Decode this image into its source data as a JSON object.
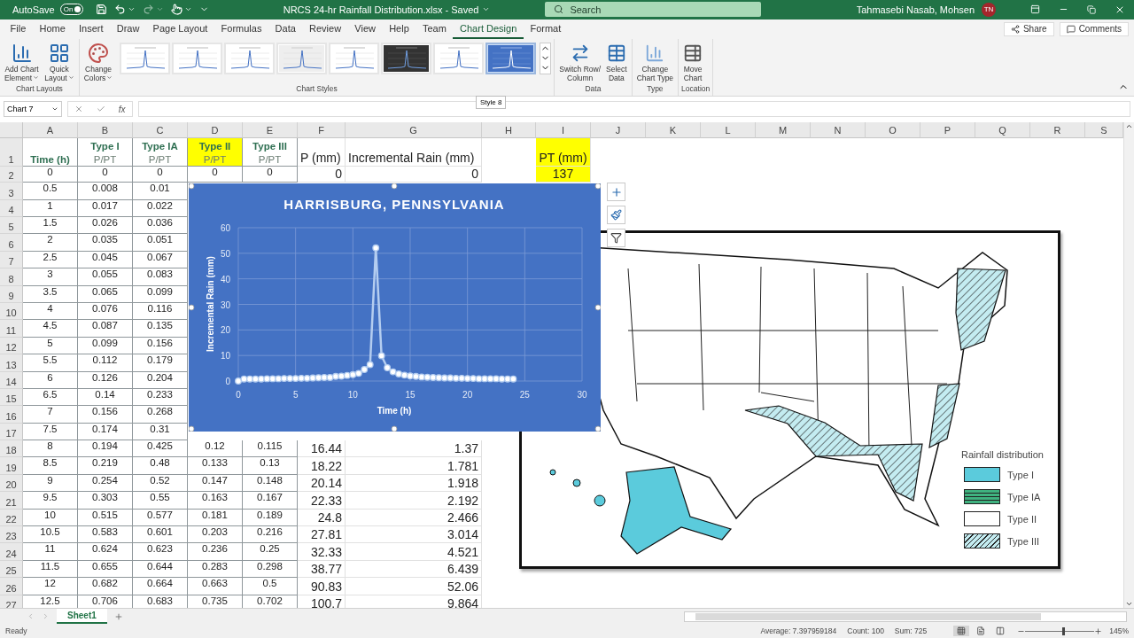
{
  "title_bar": {
    "autosave": {
      "label": "AutoSave",
      "toggle": "On",
      "on": true
    },
    "document": "NRCS 24-hr Rainfall Distribution.xlsx  -  Saved",
    "search": {
      "placeholder": "Search"
    },
    "user": "Tahmasebi Nasab, Mohsen",
    "avatar": "TN"
  },
  "tabs": [
    {
      "label": "File",
      "selected": false
    },
    {
      "label": "Home",
      "selected": false
    },
    {
      "label": "Insert",
      "selected": false
    },
    {
      "label": "Draw",
      "selected": false
    },
    {
      "label": "Page Layout",
      "selected": false
    },
    {
      "label": "Formulas",
      "selected": false
    },
    {
      "label": "Data",
      "selected": false
    },
    {
      "label": "Review",
      "selected": false
    },
    {
      "label": "View",
      "selected": false
    },
    {
      "label": "Help",
      "selected": false
    },
    {
      "label": "Team",
      "selected": false
    },
    {
      "label": "Chart Design",
      "selected": true
    },
    {
      "label": "Format",
      "selected": false
    }
  ],
  "share": "Share",
  "comments": "Comments",
  "ribbon": {
    "groups": [
      {
        "label": "Chart Layouts",
        "buttons": [
          {
            "kind": "element",
            "lines": [
              "Add Chart",
              "Element"
            ],
            "dropdown": true
          },
          {
            "kind": "layout",
            "lines": [
              "Quick",
              "Layout"
            ],
            "dropdown": true
          }
        ]
      },
      {
        "label": "Chart Styles",
        "buttons": [
          {
            "kind": "colors",
            "lines": [
              "Change",
              "Colors"
            ],
            "dropdown": true
          }
        ],
        "gallery": [
          {
            "kind": "light",
            "selected": false
          },
          {
            "kind": "light",
            "selected": false
          },
          {
            "kind": "light",
            "selected": false
          },
          {
            "kind": "shaded",
            "selected": false
          },
          {
            "kind": "light",
            "selected": false
          },
          {
            "kind": "dark",
            "selected": false
          },
          {
            "kind": "light",
            "selected": false
          },
          {
            "kind": "blue",
            "selected": true
          }
        ]
      },
      {
        "label": "Data",
        "buttons": [
          {
            "kind": "switch",
            "lines": [
              "Switch Row/",
              "Column"
            ],
            "dropdown": false
          },
          {
            "kind": "select",
            "lines": [
              "Select",
              "Data"
            ],
            "dropdown": false
          }
        ]
      },
      {
        "label": "Type",
        "buttons": [
          {
            "kind": "type",
            "lines": [
              "Change",
              "Chart Type"
            ],
            "dropdown": false
          }
        ]
      },
      {
        "label": "Location",
        "buttons": [
          {
            "kind": "move",
            "lines": [
              "Move",
              "Chart"
            ],
            "dropdown": false
          }
        ]
      }
    ],
    "tooltip": "Style 8"
  },
  "formula_bar": {
    "name_box": "Chart 7",
    "function_label": "fx"
  },
  "sheet": {
    "columns": [
      "A",
      "B",
      "C",
      "D",
      "E",
      "F",
      "G",
      "H",
      "I",
      "J",
      "K",
      "L",
      "M",
      "N",
      "O",
      "P",
      "Q",
      "R",
      "S"
    ],
    "rows": [
      {
        "number": "1",
        "cells": [
          {
            "kind": "header",
            "title": "Time (h)"
          },
          {
            "kind": "header",
            "title": "Type I",
            "unit": "P/PT"
          },
          {
            "kind": "header",
            "title": "Type IA",
            "unit": "P/PT"
          },
          {
            "kind": "header",
            "title": "Type II",
            "unit": "P/PT",
            "highlighted": true
          },
          {
            "kind": "header",
            "title": "Type III",
            "unit": "P/PT"
          },
          {
            "kind": "label",
            "text": "P (mm)"
          },
          {
            "kind": "label",
            "text": "Incremental Rain (mm)"
          },
          null,
          {
            "kind": "label",
            "text": "PT (mm)",
            "highlighted": true
          }
        ]
      },
      {
        "number": "2",
        "cells": [
          "0",
          "0",
          "0",
          "0",
          "0",
          "0",
          "0",
          null,
          {
            "kind": "value",
            "text": "137",
            "highlighted": true
          }
        ]
      },
      {
        "number": "3",
        "cells": [
          "0.5",
          "0.008",
          "0.01"
        ]
      },
      {
        "number": "4",
        "cells": [
          "1",
          "0.017",
          "0.022"
        ]
      },
      {
        "number": "5",
        "cells": [
          "1.5",
          "0.026",
          "0.036"
        ]
      },
      {
        "number": "6",
        "cells": [
          "2",
          "0.035",
          "0.051"
        ]
      },
      {
        "number": "7",
        "cells": [
          "2.5",
          "0.045",
          "0.067"
        ]
      },
      {
        "number": "8",
        "cells": [
          "3",
          "0.055",
          "0.083"
        ]
      },
      {
        "number": "9",
        "cells": [
          "3.5",
          "0.065",
          "0.099"
        ]
      },
      {
        "number": "10",
        "cells": [
          "4",
          "0.076",
          "0.116"
        ]
      },
      {
        "number": "11",
        "cells": [
          "4.5",
          "0.087",
          "0.135"
        ]
      },
      {
        "number": "12",
        "cells": [
          "5",
          "0.099",
          "0.156"
        ]
      },
      {
        "number": "13",
        "cells": [
          "5.5",
          "0.112",
          "0.179"
        ]
      },
      {
        "number": "14",
        "cells": [
          "6",
          "0.126",
          "0.204"
        ]
      },
      {
        "number": "15",
        "cells": [
          "6.5",
          "0.14",
          "0.233"
        ]
      },
      {
        "number": "16",
        "cells": [
          "7",
          "0.156",
          "0.268"
        ]
      },
      {
        "number": "17",
        "cells": [
          "7.5",
          "0.174",
          "0.31"
        ]
      },
      {
        "number": "18",
        "cells": [
          "8",
          "0.194",
          "0.425",
          "0.12",
          "0.115",
          "16.44",
          "1.37"
        ]
      },
      {
        "number": "19",
        "cells": [
          "8.5",
          "0.219",
          "0.48",
          "0.133",
          "0.13",
          "18.22",
          "1.781"
        ]
      },
      {
        "number": "20",
        "cells": [
          "9",
          "0.254",
          "0.52",
          "0.147",
          "0.148",
          "20.14",
          "1.918"
        ]
      },
      {
        "number": "21",
        "cells": [
          "9.5",
          "0.303",
          "0.55",
          "0.163",
          "0.167",
          "22.33",
          "2.192"
        ]
      },
      {
        "number": "22",
        "cells": [
          "10",
          "0.515",
          "0.577",
          "0.181",
          "0.189",
          "24.8",
          "2.466"
        ]
      },
      {
        "number": "23",
        "cells": [
          "10.5",
          "0.583",
          "0.601",
          "0.203",
          "0.216",
          "27.81",
          "3.014"
        ]
      },
      {
        "number": "24",
        "cells": [
          "11",
          "0.624",
          "0.623",
          "0.236",
          "0.25",
          "32.33",
          "4.521"
        ]
      },
      {
        "number": "25",
        "cells": [
          "11.5",
          "0.655",
          "0.644",
          "0.283",
          "0.298",
          "38.77",
          "6.439"
        ]
      },
      {
        "number": "26",
        "cells": [
          "12",
          "0.682",
          "0.664",
          "0.663",
          "0.5",
          "90.83",
          "52.06"
        ]
      },
      {
        "number": "27",
        "cells": [
          "12.5",
          "0.706",
          "0.683",
          "0.735",
          "0.702",
          "100.7",
          "9.864"
        ]
      }
    ]
  },
  "chart": {
    "side_buttons": [
      {
        "kind": "plus"
      },
      {
        "kind": "brush"
      },
      {
        "kind": "filter"
      }
    ],
    "chart_data": {
      "type": "line",
      "title": "HARRISBURG, PENNSYLVANIA",
      "xlabel": "Time (h)",
      "ylabel": "Incremental Rain (mm)",
      "x": [
        0,
        0.5,
        1,
        1.5,
        2,
        2.5,
        3,
        3.5,
        4,
        4.5,
        5,
        5.5,
        6,
        6.5,
        7,
        7.5,
        8,
        8.5,
        9,
        9.5,
        10,
        10.5,
        11,
        11.5,
        12,
        12.5,
        13,
        13.5,
        14,
        14.5,
        15,
        15.5,
        16,
        16.5,
        17,
        17.5,
        18,
        18.5,
        19,
        19.5,
        20,
        20.5,
        21,
        21.5,
        22,
        22.5,
        23,
        23.5,
        24
      ],
      "grid": true,
      "series": [
        {
          "color": "#b4cdf0",
          "marker": true,
          "values": [
            0,
            0.8,
            0.8,
            0.8,
            0.8,
            0.9,
            0.9,
            0.9,
            1,
            1,
            1,
            1.1,
            1.1,
            1.2,
            1.3,
            1.4,
            1.4,
            1.8,
            1.9,
            2.2,
            2.5,
            3,
            4.5,
            6.4,
            52.1,
            9.9,
            5.2,
            3.6,
            2.8,
            2.3,
            2,
            1.8,
            1.6,
            1.5,
            1.4,
            1.3,
            1.2,
            1.2,
            1.1,
            1.1,
            1,
            1,
            0.9,
            0.9,
            0.9,
            0.9,
            0.8,
            0.8,
            0.8
          ]
        }
      ],
      "xlim": [
        0,
        30
      ],
      "ylim": [
        0,
        60
      ],
      "xticks": [
        0,
        5,
        10,
        15,
        20,
        25,
        30
      ],
      "yticks": [
        0,
        10,
        20,
        30,
        40,
        50,
        60
      ]
    }
  },
  "map": {
    "legend": {
      "title": "Rainfall distribution",
      "items": [
        {
          "label": "Type I",
          "color": "#5bcbdc",
          "hatched": false
        },
        {
          "label": "Type IA",
          "color": "#3fb27f",
          "hatched": true
        },
        {
          "label": "Type II",
          "color": "#ffffff",
          "hatched": false
        },
        {
          "label": "Type III",
          "color": "#c4ecf1",
          "hatched": true
        }
      ]
    }
  },
  "sheet_tabs": [
    {
      "label": "Sheet1",
      "selected": true
    }
  ],
  "status_bar": {
    "status": "Ready",
    "stats": [
      "Average: 7.397959184",
      "Count: 100",
      "Sum: 725"
    ],
    "views": [
      {
        "kind": "normal",
        "selected": true
      },
      {
        "kind": "page-layout",
        "selected": false
      },
      {
        "kind": "page-break",
        "selected": false
      }
    ],
    "zoom": {
      "level": 0.55,
      "reading": "145%"
    }
  }
}
